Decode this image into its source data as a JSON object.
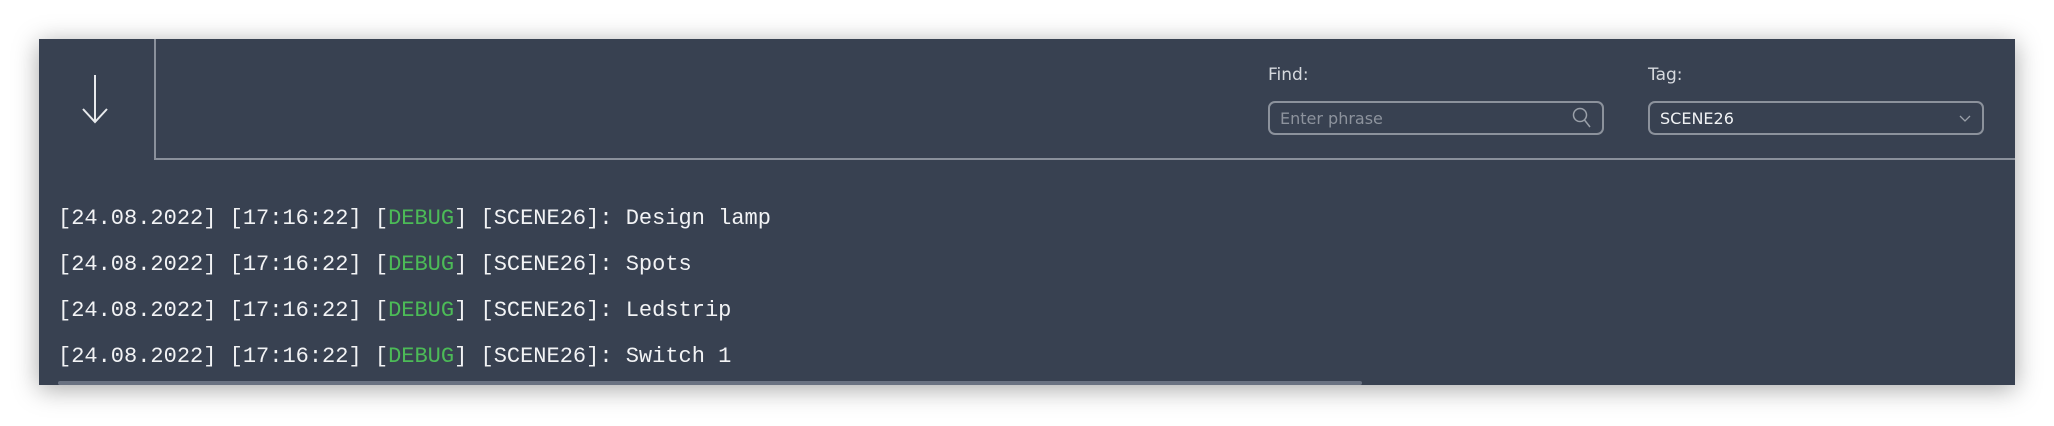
{
  "toolbar": {
    "scroll_down_icon": "arrow-down-icon"
  },
  "filters": {
    "find_label": "Find:",
    "find_placeholder": "Enter phrase",
    "find_value": "",
    "tag_label": "Tag:",
    "tag_value": "SCENE26"
  },
  "colors": {
    "background": "#384151",
    "debug": "#4cbb57"
  },
  "log": [
    {
      "date": "[24.08.2022]",
      "time": "[17:16:22]",
      "level": "DEBUG",
      "tag": "[SCENE26]:",
      "message": "Design lamp"
    },
    {
      "date": "[24.08.2022]",
      "time": "[17:16:22]",
      "level": "DEBUG",
      "tag": "[SCENE26]:",
      "message": "Spots"
    },
    {
      "date": "[24.08.2022]",
      "time": "[17:16:22]",
      "level": "DEBUG",
      "tag": "[SCENE26]:",
      "message": "Ledstrip"
    },
    {
      "date": "[24.08.2022]",
      "time": "[17:16:22]",
      "level": "DEBUG",
      "tag": "[SCENE26]:",
      "message": "Switch 1"
    }
  ]
}
